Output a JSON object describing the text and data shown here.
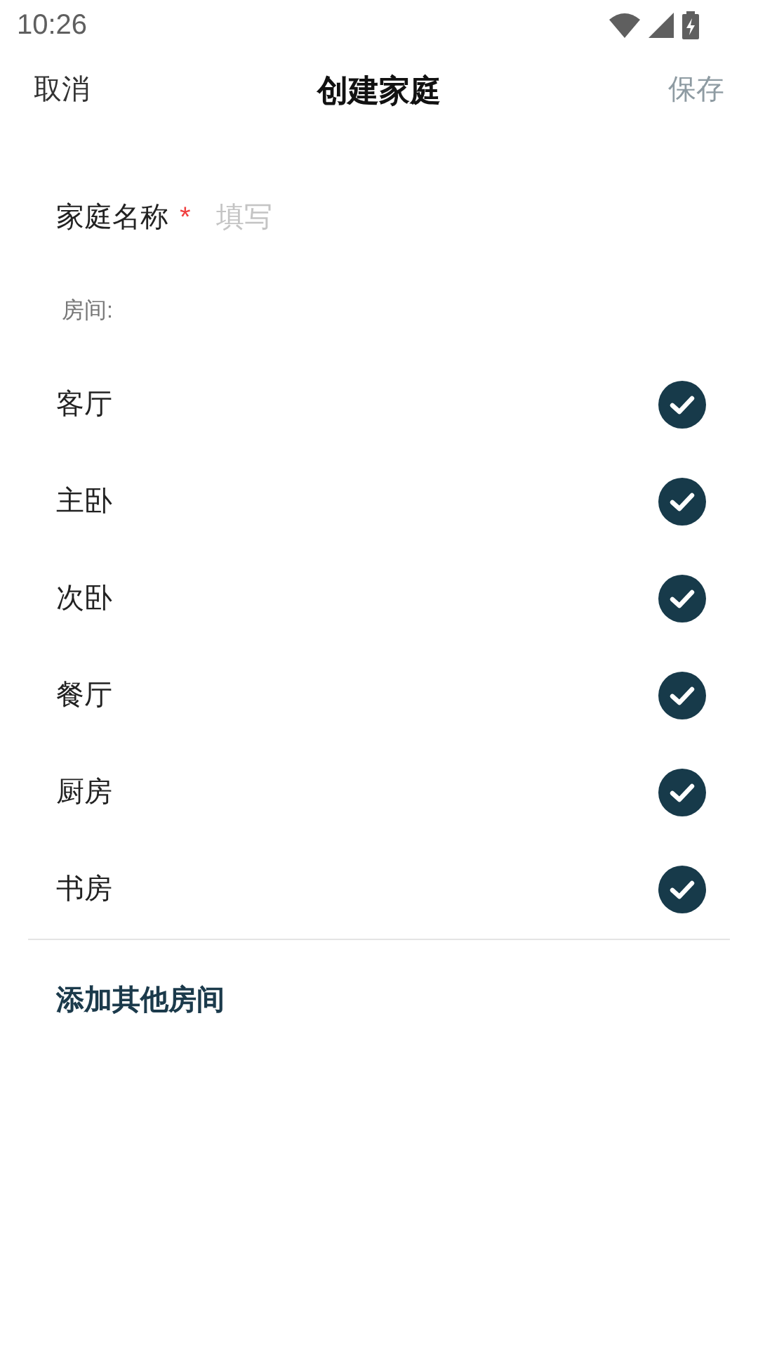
{
  "status_bar": {
    "time": "10:26"
  },
  "header": {
    "cancel": "取消",
    "title": "创建家庭",
    "save": {
      "label": "保存",
      "disabled": true
    }
  },
  "name_field": {
    "label": "家庭名称",
    "required_mark": "*",
    "placeholder": "填写"
  },
  "rooms_label": "房间:",
  "rooms": [
    {
      "name": "客厅",
      "checked": true
    },
    {
      "name": "主卧",
      "checked": true
    },
    {
      "name": "次卧",
      "checked": true
    },
    {
      "name": "餐厅",
      "checked": true
    },
    {
      "name": "厨房",
      "checked": true
    },
    {
      "name": "书房",
      "checked": true
    }
  ],
  "add_room": "添加其他房间"
}
